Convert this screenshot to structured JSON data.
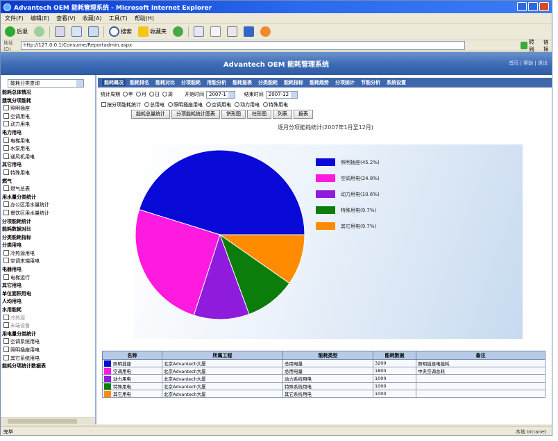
{
  "window": {
    "title": "Advantech OEM 能耗管理系统 - Microsoft Internet Explorer"
  },
  "menubar": {
    "items": [
      "文件(F)",
      "编辑(E)",
      "查看(V)",
      "收藏(A)",
      "工具(T)",
      "帮助(H)"
    ]
  },
  "toolbar": {
    "back": "后退",
    "search": "搜索",
    "favorites": "收藏夹"
  },
  "addressbar": {
    "label": "地址(D)",
    "url": "http://127.0.0.1/Consume/Reportadmin.aspx",
    "go": "转到",
    "links": "链接"
  },
  "banner": {
    "title": "Advantech OEM 能耗管理系统",
    "links": "首页 | 帮助 | 退出"
  },
  "sidebar": {
    "select": "能耗分类查询",
    "rows": [
      {
        "text": "能耗总体情况",
        "kind": "head"
      },
      {
        "text": "建筑分项能耗",
        "kind": "head"
      },
      {
        "text": "照明插座",
        "kind": "item"
      },
      {
        "text": "空调用电",
        "kind": "item"
      },
      {
        "text": "动力用电",
        "kind": "item"
      },
      {
        "text": "电力用电",
        "kind": "head"
      },
      {
        "text": "电梯用电",
        "kind": "item"
      },
      {
        "text": "水泵用电",
        "kind": "item"
      },
      {
        "text": "通风机用电",
        "kind": "item"
      },
      {
        "text": "其它用电",
        "kind": "head"
      },
      {
        "text": "特殊用电",
        "kind": "item"
      },
      {
        "text": "燃气",
        "kind": "head"
      },
      {
        "text": "燃气总表",
        "kind": "item"
      },
      {
        "text": "用水量分类统计",
        "kind": "head"
      },
      {
        "text": "办公区用水量统计",
        "kind": "item"
      },
      {
        "text": "餐饮区用水量统计",
        "kind": "item"
      },
      {
        "text": "分项能耗统计",
        "kind": "head"
      },
      {
        "text": "能耗数据对比",
        "kind": "head"
      },
      {
        "text": "分类能耗指标",
        "kind": "head"
      },
      {
        "text": "分类用电",
        "kind": "head"
      },
      {
        "text": "冷热源用电",
        "kind": "item"
      },
      {
        "text": "空调末端用电",
        "kind": "item"
      },
      {
        "text": "电器用电",
        "kind": "head"
      },
      {
        "text": "电梯运行",
        "kind": "item"
      },
      {
        "text": "其它用电",
        "kind": "head"
      },
      {
        "text": "单位面积用电",
        "kind": "head"
      },
      {
        "text": "人均用电",
        "kind": "head"
      },
      {
        "text": "水用能耗",
        "kind": "head"
      },
      {
        "text": "冷热源",
        "kind": "item",
        "dim": true
      },
      {
        "text": "末端设备",
        "kind": "item",
        "dim": true
      },
      {
        "text": "用电量分类统计",
        "kind": "head"
      },
      {
        "text": "空调系统用电",
        "kind": "item"
      },
      {
        "text": "照明插座用电",
        "kind": "item"
      },
      {
        "text": "其它系统用电",
        "kind": "item"
      },
      {
        "text": "能耗分项统计数据表",
        "kind": "head"
      }
    ]
  },
  "main": {
    "tabs": [
      "能耗概况",
      "能耗排名",
      "能耗对比",
      "分项能耗",
      "用能分析",
      "能耗报表",
      "分类能耗",
      "能耗指标",
      "能耗趋势",
      "分项统计",
      "节能分析",
      "系统设置"
    ],
    "active_tab": 0,
    "filter1": {
      "label": "统计周期",
      "radios": [
        "年",
        "月",
        "日",
        "周"
      ],
      "start_label": "开始时间",
      "start_value": "2007-1",
      "end_label": "结束时间",
      "end_value": "2007-12"
    },
    "filter2": {
      "check_label": "按分项能耗统计",
      "radios": [
        "总用电",
        "照明插座用电",
        "空调用电",
        "动力用电",
        "特殊用电"
      ]
    },
    "subtabs": [
      "能耗总量统计",
      "分项能耗统计图表",
      "饼形图",
      "柱形图",
      "列表",
      "报表"
    ],
    "chart_title": "逐月分项能耗统计(2007年1月至12月)"
  },
  "chart_data": {
    "type": "pie",
    "title": "",
    "series": [
      {
        "name": "照明插座(45.2%)",
        "value": 45.2,
        "color": "#0a0ad8"
      },
      {
        "name": "空调用电(24.8%)",
        "value": 24.8,
        "color": "#ff1adf"
      },
      {
        "name": "动力用电(10.6%)",
        "value": 10.6,
        "color": "#8f1bdd"
      },
      {
        "name": "特殊用电(9.7%)",
        "value": 9.7,
        "color": "#0a7d0a"
      },
      {
        "name": "其它用电(9.7%)",
        "value": 9.7,
        "color": "#ff8c00"
      }
    ],
    "start_angle_deg": 0,
    "legend": "top-right"
  },
  "table": {
    "headers": [
      "名称",
      "所属工程",
      "能耗类型",
      "能耗数据",
      "备注"
    ],
    "rows": [
      {
        "color": "#0a0ad8",
        "name": "照明插座",
        "project": "北京Advantech大厦",
        "type": "总用电量",
        "value": "3200",
        "note": "照明插座电能耗"
      },
      {
        "color": "#ff1adf",
        "name": "空调用电",
        "project": "北京Advantech大厦",
        "type": "总用电量",
        "value": "1800",
        "note": "中央空调总耗"
      },
      {
        "color": "#8f1bdd",
        "name": "动力用电",
        "project": "北京Advantech大厦",
        "type": "动力系统用电",
        "value": "1000",
        "note": ""
      },
      {
        "color": "#0a7d0a",
        "name": "特殊用电",
        "project": "北京Advantech大厦",
        "type": "特殊系统用电",
        "value": "1000",
        "note": ""
      },
      {
        "color": "#ff8c00",
        "name": "其它用电",
        "project": "北京Advantech大厦",
        "type": "其它系统用电",
        "value": "1000",
        "note": ""
      }
    ]
  },
  "statusbar": {
    "left": "完毕",
    "right": "本地 Intranet"
  }
}
